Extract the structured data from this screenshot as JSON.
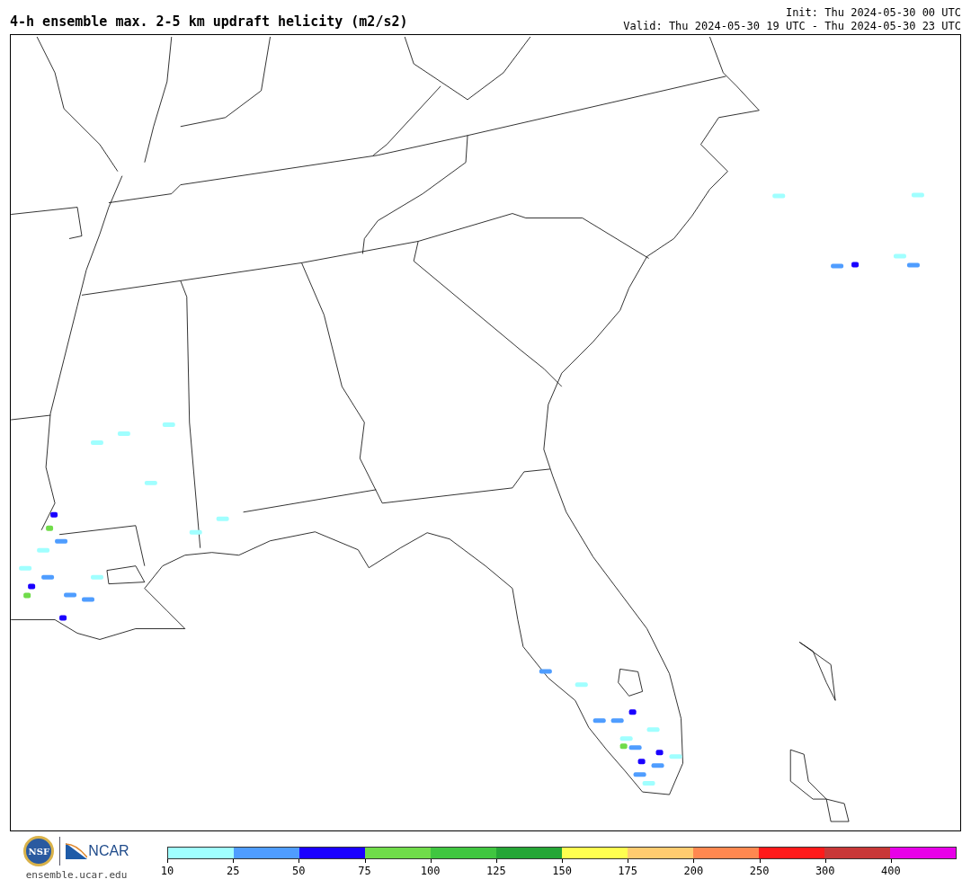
{
  "title": "4-h ensemble max. 2-5 km updraft helicity (m2/s2)",
  "init": "Init: Thu 2024-05-30 00 UTC",
  "valid": "Valid: Thu 2024-05-30 19 UTC - Thu 2024-05-30 23 UTC",
  "logos": {
    "nsf": "NSF",
    "ncar": "NCAR",
    "website": "ensemble.ucar.edu"
  },
  "colorbar": [
    {
      "label": "10",
      "color": "#a0ffff"
    },
    {
      "label": "25",
      "color": "#4f9dff"
    },
    {
      "label": "50",
      "color": "#1a00ff"
    },
    {
      "label": "75",
      "color": "#70dc4a"
    },
    {
      "label": "100",
      "color": "#40c640"
    },
    {
      "label": "125",
      "color": "#25a636"
    },
    {
      "label": "150",
      "color": "#ffff50"
    },
    {
      "label": "175",
      "color": "#ffcc70"
    },
    {
      "label": "200",
      "color": "#ff8850"
    },
    {
      "label": "250",
      "color": "#ff1a1a"
    },
    {
      "label": "300",
      "color": "#c83838"
    },
    {
      "label": "400",
      "color": "#e800e8"
    }
  ]
}
